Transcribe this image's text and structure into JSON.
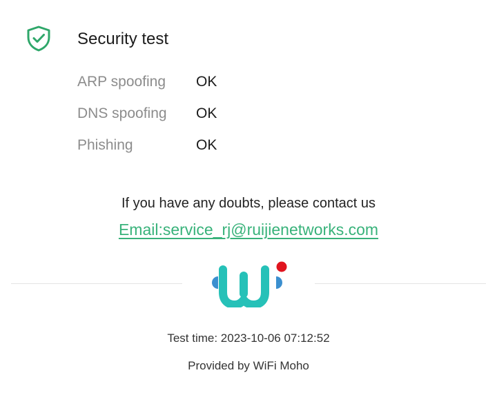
{
  "security": {
    "icon": "shield-check-icon",
    "title": "Security test",
    "accent_color": "#2fa76a",
    "checks": [
      {
        "label": "ARP spoofing",
        "result": "OK"
      },
      {
        "label": "DNS spoofing",
        "result": "OK"
      },
      {
        "label": "Phishing",
        "result": "OK"
      }
    ]
  },
  "contact": {
    "message": "If you have any doubts, please contact us",
    "email_link": "Email:service_rj@ruijienetworks.com",
    "link_color": "#38b27a"
  },
  "brand": {
    "logo_icon": "wifi-moho-logo-icon",
    "logo_primary_color": "#26c1b8",
    "logo_secondary_color": "#3b8fcf",
    "logo_dot_color": "#e0141e"
  },
  "footer": {
    "test_time": "Test time: 2023-10-06 07:12:52",
    "provided_by": "Provided by WiFi Moho"
  }
}
